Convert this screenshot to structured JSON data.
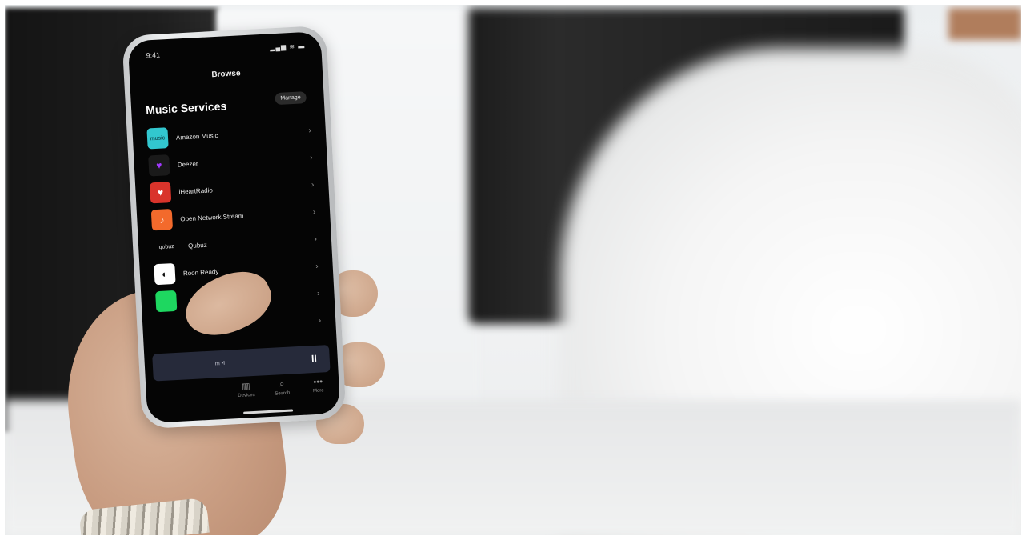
{
  "status_bar": {
    "time": "9:41",
    "icons": "▂▄▆ ≋ ▬"
  },
  "header": {
    "title": "Browse"
  },
  "music_services": {
    "title": "Music Services",
    "manage_label": "Manage",
    "items": [
      {
        "label": "Amazon Music",
        "icon": "amazon-music-icon",
        "icon_text": "music"
      },
      {
        "label": "Deezer",
        "icon": "deezer-heart-icon",
        "icon_text": "♥"
      },
      {
        "label": "iHeartRadio",
        "icon": "iheartradio-icon",
        "icon_text": "♥"
      },
      {
        "label": "Open Network Stream",
        "icon": "open-network-stream-icon",
        "icon_text": "♪"
      },
      {
        "label": "Qubuz",
        "icon": "qobuz-logo-icon",
        "icon_text": "qobuz"
      },
      {
        "label": "Roon Ready",
        "icon": "roon-ready-icon",
        "icon_text": "◐"
      },
      {
        "label": "",
        "icon": "spotify-icon",
        "icon_text": ""
      },
      {
        "label": "",
        "icon": "service-icon",
        "icon_text": ""
      }
    ],
    "chevron": "›"
  },
  "mini_player": {
    "text": "m •I",
    "pause_symbol": "II"
  },
  "tabbar": {
    "items": [
      {
        "label": "Devices",
        "icon": "devices-icon",
        "glyph": "▥"
      },
      {
        "label": "Search",
        "icon": "search-icon",
        "glyph": "⌕"
      },
      {
        "label": "More",
        "icon": "more-icon",
        "glyph": "•••"
      }
    ]
  },
  "colors": {
    "screen_bg": "#050505",
    "amazon": "#32c7cf",
    "deezer": "#a238ff",
    "iheart": "#d9342b",
    "open_network": "#f36a2c",
    "spotify": "#1ed760",
    "mini_player_bg": "#262a3a"
  }
}
